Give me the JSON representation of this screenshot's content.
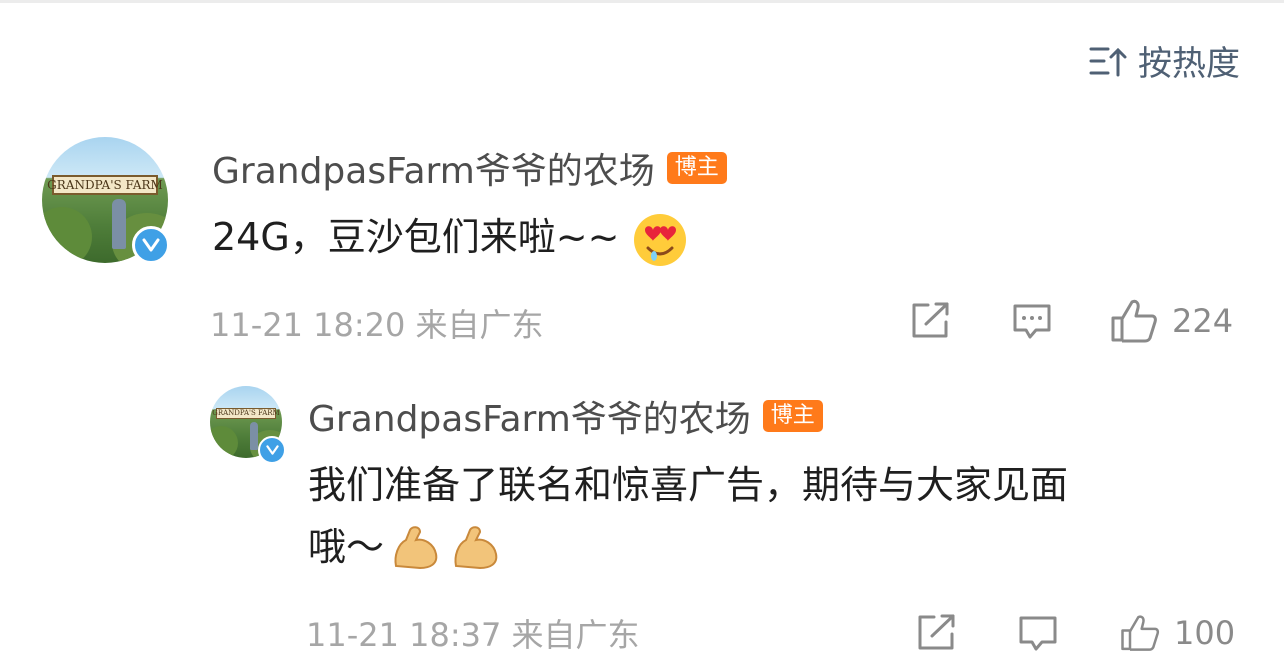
{
  "sort": {
    "label": "按热度",
    "icon": "sort-icon"
  },
  "comments": [
    {
      "avatar_text": "GRANDPA'S FARM",
      "author": "GrandpasFarm爷爷的农场",
      "tag": "博主",
      "text": "24G，豆沙包们来啦~~",
      "emoji": "heart-eyes-emoji",
      "time": "11-21 18:20 来自广东",
      "likes": "224"
    },
    {
      "avatar_text": "GRANDPA'S FARM",
      "author": "GrandpasFarm爷爷的农场",
      "tag": "博主",
      "text_line1": "我们准备了联名和惊喜广告，期待与大家见面",
      "text_line2": "哦～",
      "emoji": "flexed-biceps-emoji",
      "time": "11-21 18:37 来自广东",
      "likes": "100"
    }
  ],
  "colors": {
    "tag": "#ff7a1a",
    "verified": "#3fa0e6",
    "meta": "#a6a6a6"
  }
}
